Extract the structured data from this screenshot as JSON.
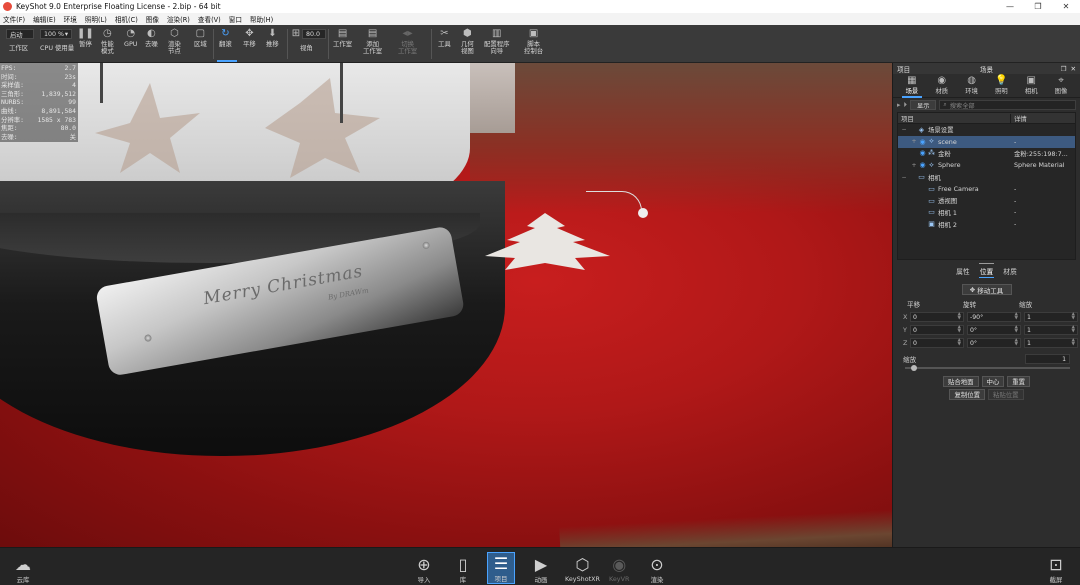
{
  "window": {
    "title": "KeyShot 9.0 Enterprise Floating License  - 2.bip  - 64 bit",
    "controls": [
      "—",
      "❐",
      "✕"
    ]
  },
  "menu": [
    "文件(F)",
    "编辑(E)",
    "环境",
    "照明(L)",
    "相机(C)",
    "图像",
    "渲染(R)",
    "查看(V)",
    "窗口",
    "帮助(H)"
  ],
  "toolbar": {
    "workspace_select": "启动",
    "workspace_label": "工作区",
    "cpu_select": "100 %",
    "cpu_label": "CPU 使用量",
    "pause_label": "暂停",
    "perf_label": "性能\n模式",
    "gpu_label": "GPU",
    "denoise_label": "去噪",
    "render_nodes_label": "渲染\n节点",
    "region_label": "区域",
    "tumble_label": "翻滚",
    "pan_label": "平移",
    "dolly_label": "推移",
    "fov_value": "80.0",
    "fov_label": "视角",
    "studio_label": "工作室",
    "add_studio_label": "添加\n工作室",
    "switch_studio_label": "切换\n工作室",
    "tools_label": "工具",
    "geometry_view_label": "几何\n视图",
    "configurator_label": "配置程序\n向导",
    "script_console_label": "脚本\n控制台"
  },
  "stats": [
    {
      "k": "FPS:",
      "v": "2.7"
    },
    {
      "k": "时间:",
      "v": "23s"
    },
    {
      "k": "采样值:",
      "v": "4"
    },
    {
      "k": "三角形:",
      "v": "1,839,512"
    },
    {
      "k": "NURBS:",
      "v": "99"
    },
    {
      "k": "曲线:",
      "v": "8,891,584"
    },
    {
      "k": "分辨率:",
      "v": "1585 x 783"
    },
    {
      "k": "焦距:",
      "v": "80.0"
    },
    {
      "k": "去噪:",
      "v": "关"
    }
  ],
  "viewport": {
    "engraving_main": "Merry Christmas",
    "engraving_sub": "By DRAWm"
  },
  "panel": {
    "left_title": "项目",
    "center_title": "场景",
    "tabs": [
      {
        "label": "场景",
        "icon": "scene-icon",
        "glyph": "▦"
      },
      {
        "label": "材质",
        "icon": "material-icon",
        "glyph": "◉"
      },
      {
        "label": "环境",
        "icon": "environment-icon",
        "glyph": "◍"
      },
      {
        "label": "照明",
        "icon": "lighting-icon",
        "glyph": "💡"
      },
      {
        "label": "相机",
        "icon": "camera-icon",
        "glyph": "▣"
      },
      {
        "label": "图像",
        "icon": "image-icon",
        "glyph": "⌖"
      }
    ],
    "show_button": "显示",
    "search_placeholder": "搜索全部",
    "tree_headers": [
      "项目",
      "详情"
    ],
    "tree": [
      {
        "name": "场景设置",
        "val": "",
        "indent": 0,
        "exp": "−",
        "eye": false,
        "icon": "◈",
        "selected": false
      },
      {
        "name": "scene",
        "val": "-",
        "indent": 1,
        "exp": "+",
        "eye": true,
        "icon": "⟡",
        "selected": true
      },
      {
        "name": "金粉",
        "val": "金粉:255:198:7...",
        "indent": 1,
        "exp": "",
        "eye": true,
        "icon": "⁂",
        "selected": false
      },
      {
        "name": "Sphere",
        "val": "Sphere Material",
        "indent": 1,
        "exp": "+",
        "eye": true,
        "icon": "⟡",
        "selected": false
      },
      {
        "name": "相机",
        "val": "",
        "indent": 0,
        "exp": "−",
        "eye": false,
        "icon": "▭",
        "selected": false
      },
      {
        "name": "Free Camera",
        "val": "-",
        "indent": 1,
        "exp": "",
        "eye": false,
        "icon": "▭",
        "selected": false
      },
      {
        "name": "透视图",
        "val": "-",
        "indent": 1,
        "exp": "",
        "eye": false,
        "icon": "▭",
        "selected": false
      },
      {
        "name": "相机 1",
        "val": "-",
        "indent": 1,
        "exp": "",
        "eye": false,
        "icon": "▭",
        "selected": false
      },
      {
        "name": "相机 2",
        "val": "-",
        "indent": 1,
        "exp": "",
        "eye": false,
        "icon": "▣",
        "selected": false
      }
    ],
    "prop_tabs": [
      "属性",
      "位置",
      "材质"
    ],
    "move_tool": "移动工具",
    "xf_headers": [
      "平移",
      "旋转",
      "缩放"
    ],
    "xf_rows": [
      {
        "axis": "X",
        "t": "0",
        "r": "-90°",
        "s": "1"
      },
      {
        "axis": "Y",
        "t": "0",
        "r": "0°",
        "s": "1"
      },
      {
        "axis": "Z",
        "t": "0",
        "r": "0°",
        "s": "1"
      }
    ],
    "scale_label": "缩放",
    "scale_value": "1",
    "snap_ground": "贴合地面",
    "center": "中心",
    "reset": "重置",
    "copy_position": "复制位置",
    "paste_position": "粘贴位置"
  },
  "bottom": {
    "cloud_label": "云库",
    "import_label": "导入",
    "library_label": "库",
    "project_label": "项目",
    "animation_label": "动画",
    "keyshotxr_label": "KeyShotXR",
    "keyvr_label": "KeyVR",
    "render_label": "渲染",
    "screenshot_label": "截屏"
  },
  "colors": {
    "accent": "#4aa3ff",
    "viewport_red": "#c81e1e",
    "panel_bg": "#2d2d2d"
  }
}
